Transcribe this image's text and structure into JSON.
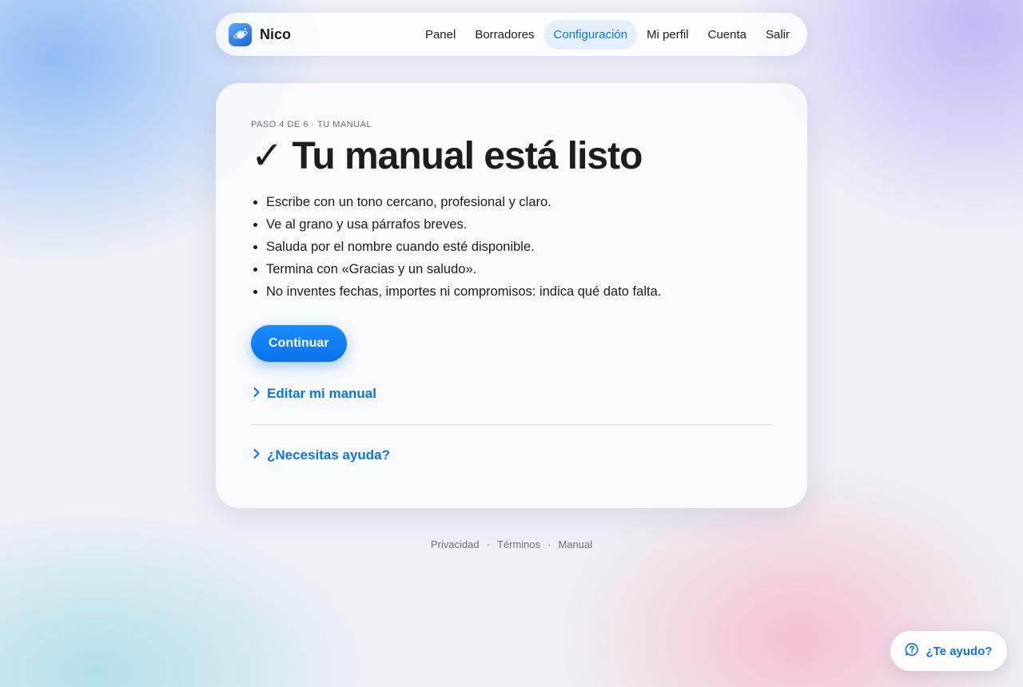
{
  "nav": {
    "brand_name": "Nico",
    "links": [
      {
        "label": "Panel",
        "active": false
      },
      {
        "label": "Borradores",
        "active": false
      },
      {
        "label": "Configuración",
        "active": true
      },
      {
        "label": "Mi perfil",
        "active": false
      },
      {
        "label": "Cuenta",
        "active": false
      },
      {
        "label": "Salir",
        "active": false
      }
    ]
  },
  "card": {
    "eyebrow": "PASO 4 DE 6 · TU MANUAL",
    "title": "✓ Tu manual está listo",
    "rules": [
      "Escribe con un tono cercano, profesional y claro.",
      "Ve al grano y usa párrafos breves.",
      "Saluda por el nombre cuando esté disponible.",
      "Termina con «Gracias y un saludo».",
      "No inventes fechas, importes ni compromisos: indica qué dato falta."
    ],
    "continue_label": "Continuar",
    "edit_label": "Editar mi manual",
    "help_label": "¿Necesitas ayuda?"
  },
  "footer": {
    "links": [
      "Privacidad",
      "Términos",
      "Manual"
    ],
    "separator": "·"
  },
  "help_button": {
    "label": "¿Te ayudo?"
  },
  "colors": {
    "accent": "#0a76e0",
    "button": "#0a72ea",
    "active_tab_bg": "#e3effd"
  },
  "icons": [
    "planet-logo-icon",
    "chevron-right-icon",
    "help-chat-icon"
  ]
}
